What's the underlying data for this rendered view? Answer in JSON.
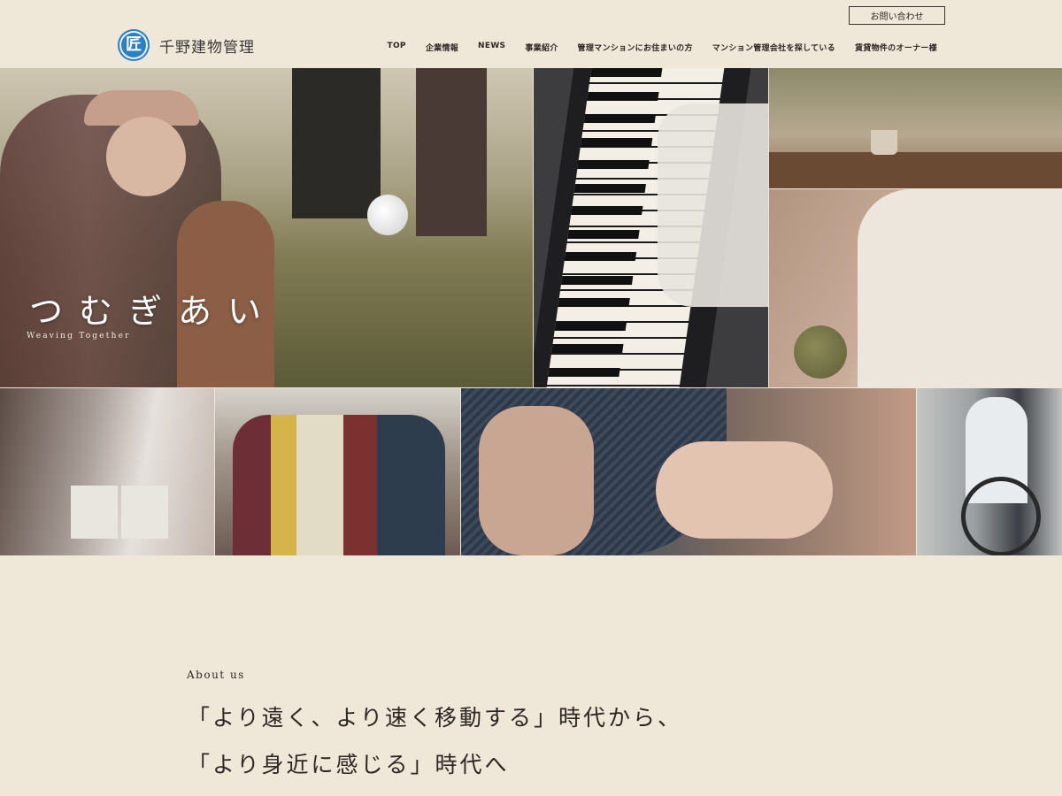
{
  "header": {
    "logo_mark": "匠",
    "company_name": "千野建物管理",
    "contact_button": "お問い合わせ",
    "nav": [
      "TOP",
      "企業情報",
      "NEWS",
      "事業紹介",
      "管理マンションにお住まいの方",
      "マンション管理会社を探している",
      "賃貸物件のオーナー様"
    ]
  },
  "hero": {
    "title": "つむぎあい",
    "subtitle": "Weaving Together"
  },
  "about": {
    "label": "About us",
    "line1": "「より遠く、より速く移動する」時代から、",
    "line2": "「より身近に感じる」時代へ"
  },
  "colors": {
    "background": "#efe7d8",
    "logo_blue": "#2e7fc1",
    "text": "#2b2723"
  }
}
